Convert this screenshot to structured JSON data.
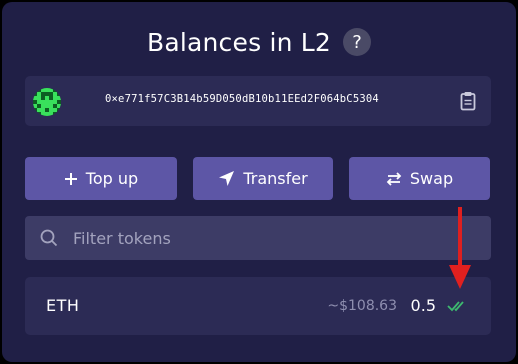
{
  "header": {
    "title": "Balances in L2",
    "help_icon": "?"
  },
  "account": {
    "address": "0×e771f57C3B14b59D050dB10b11EEd2F064bC5304",
    "avatar_icon": "identicon",
    "copy_icon": "clipboard-icon"
  },
  "actions": {
    "top_up_label": "Top up",
    "transfer_label": "Transfer",
    "swap_label": "Swap"
  },
  "filter": {
    "placeholder": "Filter tokens",
    "value": ""
  },
  "tokens": [
    {
      "symbol": "ETH",
      "usd_value": "~$108.63",
      "amount": "0.5",
      "status_icon": "double-check-icon",
      "status_color": "#3db96f"
    }
  ],
  "colors": {
    "background": "#201f46",
    "button": "#5d56a6",
    "input": "#3d3c66",
    "annotation_arrow": "#e0201f"
  }
}
